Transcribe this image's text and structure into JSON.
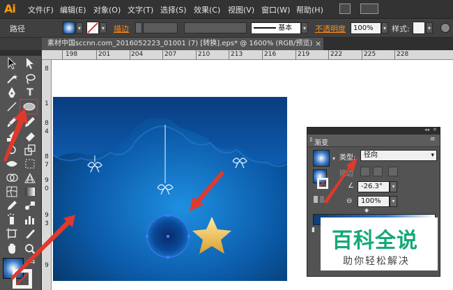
{
  "app": {
    "logo": "Ai"
  },
  "menu": {
    "items": [
      "文件(F)",
      "编辑(E)",
      "对象(O)",
      "文字(T)",
      "选择(S)",
      "效果(C)",
      "视图(V)",
      "窗口(W)",
      "帮助(H)"
    ]
  },
  "control_bar": {
    "object_type": "路径",
    "stroke_label": "描边",
    "stroke_profile": "基本",
    "opacity_label": "不透明度",
    "opacity_value": "100%",
    "style_label": "样式:"
  },
  "document": {
    "tab_title": "素材中国sccnn.com_2016052223_01001  (7)  [转换].eps* @ 1600% (RGB/预览)",
    "close_glyph": "×"
  },
  "ruler": {
    "h_ticks": [
      "198",
      "201",
      "204",
      "207",
      "210",
      "213",
      "216",
      "219",
      "222",
      "225",
      "228"
    ],
    "v_ticks": [
      "8",
      "1",
      "8",
      "4",
      "8",
      "7",
      "9",
      "0",
      "9",
      "3",
      "9"
    ]
  },
  "gradient_panel": {
    "title": "渐变",
    "type_label": "类型:",
    "type_value": "径向",
    "stroke_label": "描边",
    "angle_value": "-26.3°",
    "aspect_value": "100%"
  },
  "watermark": {
    "logo": "百科全说",
    "sub": "助你轻松解决"
  },
  "colors": {
    "accent": "#ff8c1a",
    "highlight": "#e0392b",
    "background_blue": "#0d5fae",
    "star": "#f0c040"
  }
}
